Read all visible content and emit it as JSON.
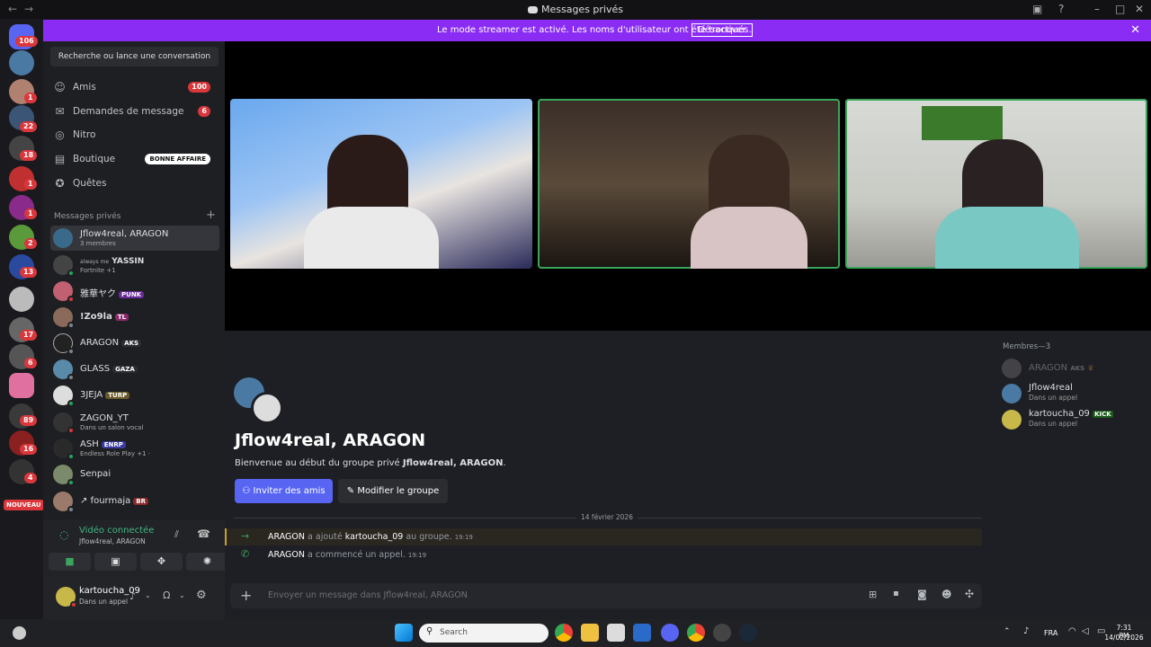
{
  "window": {
    "title": "Messages privés"
  },
  "banner": {
    "message": "Le mode streamer est activé. Les noms d'utilisateur ont été tronqués.",
    "button": "Désactiver"
  },
  "servers": {
    "badges": [
      "106",
      "1",
      "22",
      "18",
      "1",
      "1",
      "2",
      "13",
      "17",
      "6",
      "89",
      "16",
      "4"
    ],
    "new_label": "NOUVEAU"
  },
  "sidebar": {
    "search": "Recherche ou lance une conversation",
    "nav": [
      {
        "label": "Amis",
        "icon": "friends-icon",
        "count": "100"
      },
      {
        "label": "Demandes de message",
        "icon": "envelope-icon",
        "count": "6"
      },
      {
        "label": "Nitro",
        "icon": "nitro-icon"
      },
      {
        "label": "Boutique",
        "icon": "shop-icon",
        "deal": "BONNE AFFAIRE"
      },
      {
        "label": "Quêtes",
        "icon": "quests-icon"
      }
    ],
    "dm_header": "Messages privés",
    "dms": [
      {
        "name": "Jflow4real, ARAGON",
        "sub": "3 membres"
      },
      {
        "name": "YASSIN",
        "prefix": "always me",
        "sub": "Fortnite +1"
      },
      {
        "name": "雅華ヤク",
        "tag": "PUNK"
      },
      {
        "name": "!Zo9la",
        "tag": "TL"
      },
      {
        "name": "ARAGON",
        "tag": "AKS"
      },
      {
        "name": "GLASS",
        "tag": "GAZA"
      },
      {
        "name": "3JEJA",
        "tag": "TURP"
      },
      {
        "name": "ZAGON_YT",
        "sub": "Dans un salon vocal"
      },
      {
        "name": "ASH",
        "tag": "ENRP",
        "sub": "Endless Role Play +1 ·"
      },
      {
        "name": "Senpai"
      },
      {
        "name": "fourmaja",
        "prefix": "↗",
        "tag": "BR"
      }
    ]
  },
  "voice": {
    "status": "Vidéo connectée",
    "channel": "Jflow4real, ARAGON"
  },
  "user": {
    "name": "kartoucha_09",
    "status": "Dans un appel"
  },
  "group": {
    "title": "Jflow4real, ARAGON",
    "welcome_prefix": "Bienvenue au début du groupe privé",
    "welcome_name": "Jflow4real, ARAGON",
    "welcome_suffix": ".",
    "invite_button": "Inviter des amis",
    "edit_button": "Modifier le groupe"
  },
  "messages": {
    "date": "14 février 2026",
    "items": [
      {
        "actor": "ARAGON",
        "verb": "a ajouté",
        "target": "kartoucha_09",
        "rest": "au groupe.",
        "time": "19:19"
      },
      {
        "actor": "ARAGON",
        "verb": "a commencé un appel.",
        "time": "19:19"
      }
    ]
  },
  "composer": {
    "placeholder": "Envoyer un message dans Jflow4real, ARAGON"
  },
  "members": {
    "header": "Membres—3",
    "list": [
      {
        "name": "ARAGON",
        "tag": "AKS"
      },
      {
        "name": "Jflow4real",
        "sub": "Dans un appel"
      },
      {
        "name": "kartoucha_09",
        "tag": "KICK",
        "sub": "Dans un appel"
      }
    ]
  },
  "taskbar": {
    "search": "Search",
    "lang": "FRA",
    "time": "7:31 PM",
    "date": "14/02/2026"
  },
  "colors": {
    "accent": "#8b2cf5",
    "blurple": "#5865f2",
    "online": "#23a55a",
    "danger": "#da373c",
    "speaking": "#3ba55c"
  }
}
